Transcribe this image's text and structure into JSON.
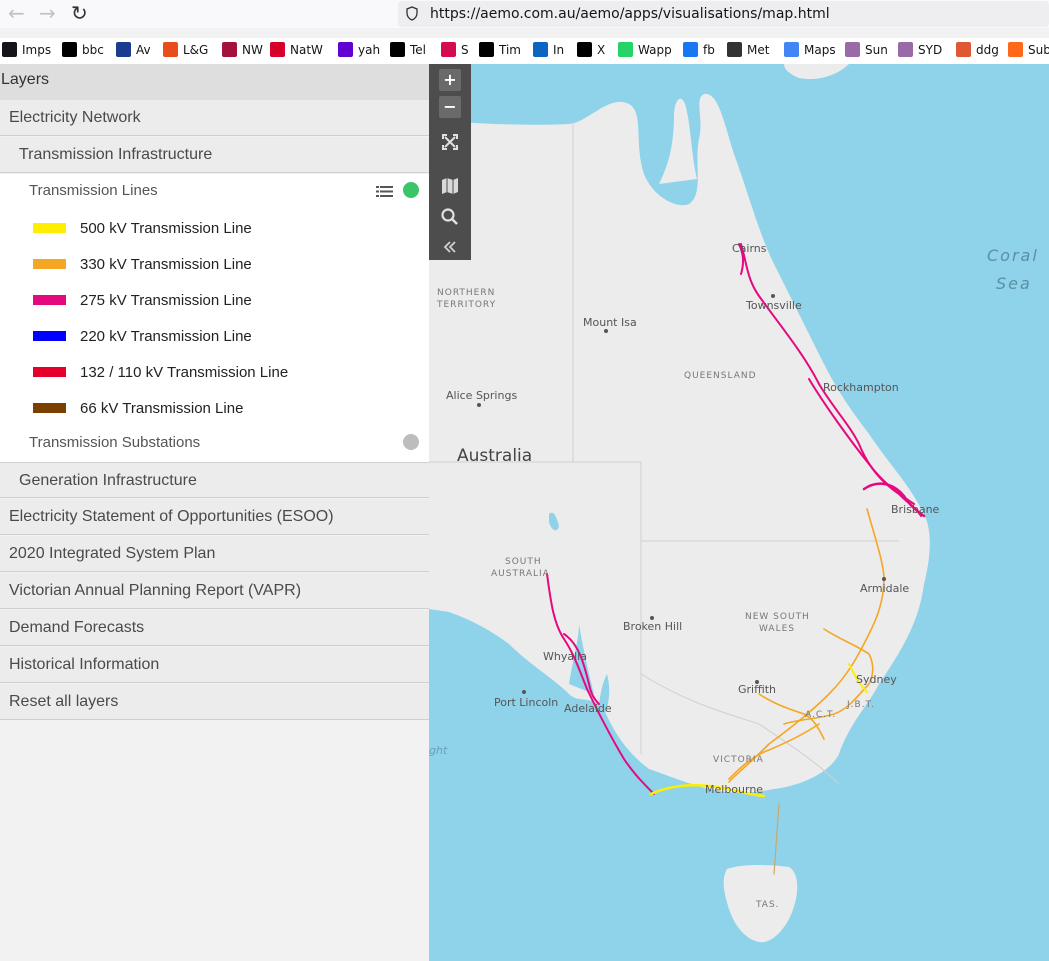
{
  "browser": {
    "url": "https://aemo.com.au/aemo/apps/visualisations/map.html",
    "back_icon": "arrow-left-icon",
    "forward_icon": "arrow-right-icon",
    "reload_icon": "reload-icon",
    "bookmarks": [
      {
        "label": "Imps",
        "icon": "folder-icon",
        "color": "#15141a"
      },
      {
        "label": "bbc",
        "icon": "bbc-icon",
        "color": "#000000"
      },
      {
        "label": "Av",
        "icon": "aviva-icon",
        "color": "#1a3c8f"
      },
      {
        "label": "L&G",
        "icon": "umbrella-icon",
        "color": "#e84e1b"
      },
      {
        "label": "NW",
        "icon": "nationwide-icon",
        "color": "#a3123b"
      },
      {
        "label": "NatW",
        "icon": "natwest-icon",
        "color": "#d7002a"
      },
      {
        "label": "yah",
        "icon": "yahoo-icon",
        "color": "#6001d2"
      },
      {
        "label": "Tel",
        "icon": "telegraph-icon",
        "color": "#000000"
      },
      {
        "label": "S",
        "icon": "s-icon",
        "color": "#d40b53"
      },
      {
        "label": "Tim",
        "icon": "times-icon",
        "color": "#000000"
      },
      {
        "label": "In",
        "icon": "linkedin-icon",
        "color": "#0a66c2"
      },
      {
        "label": "X",
        "icon": "x-icon",
        "color": "#000000"
      },
      {
        "label": "Wapp",
        "icon": "whatsapp-icon",
        "color": "#25d366"
      },
      {
        "label": "fb",
        "icon": "facebook-icon",
        "color": "#1877f2"
      },
      {
        "label": "Met",
        "icon": "met-icon",
        "color": "#333333"
      },
      {
        "label": "Maps",
        "icon": "google-icon",
        "color": "#4285f4"
      },
      {
        "label": "Sun",
        "icon": "sun-icon",
        "color": "#9a6aa8"
      },
      {
        "label": "SYD",
        "icon": "syd-icon",
        "color": "#9a6aa8"
      },
      {
        "label": "ddg",
        "icon": "duckduckgo-icon",
        "color": "#de5833"
      },
      {
        "label": "Sub",
        "icon": "substack-icon",
        "color": "#ff6719"
      }
    ]
  },
  "sidebar": {
    "title": "Layers",
    "electricity_network": "Electricity Network",
    "transmission_infrastructure": "Transmission Infrastructure",
    "transmission_lines": "Transmission Lines",
    "list_icon": "list-icon",
    "lines_status_color": "#3cc468",
    "legend": [
      {
        "label": "500 kV Transmission Line",
        "color": "#ffee00"
      },
      {
        "label": "330 kV Transmission Line",
        "color": "#f5a623"
      },
      {
        "label": "275 kV Transmission Line",
        "color": "#e5097f"
      },
      {
        "label": "220 kV Transmission Line",
        "color": "#0000ff"
      },
      {
        "label": "132 / 110 kV Transmission Line",
        "color": "#e4002b"
      },
      {
        "label": "66 kV Transmission Line",
        "color": "#7b3f00"
      }
    ],
    "transmission_substations": "Transmission Substations",
    "substations_status_color": "#bdbdbd",
    "generation_infrastructure": "Generation Infrastructure",
    "sections": [
      "Electricity Statement of Opportunities (ESOO)",
      "2020 Integrated System Plan",
      "Victorian Annual Planning Report (VAPR)",
      "Demand Forecasts",
      "Historical Information",
      "Reset all layers"
    ]
  },
  "map_tools": {
    "zoom_in": "+",
    "zoom_out": "−",
    "fullscreen_icon": "fullscreen-icon",
    "basemap_icon": "map-icon",
    "search_icon": "search-icon",
    "collapse_icon": "double-chevron-left-icon"
  },
  "map": {
    "country": "Australia",
    "sea": [
      "Coral",
      "Sea"
    ],
    "regions": [
      "NORTHERN",
      "TERRITORY",
      "QUEENSLAND",
      "SOUTH",
      "AUSTRALIA",
      "NEW SOUTH",
      "WALES",
      "VICTORIA",
      "A.C.T.",
      "J.B.T.",
      "TAS."
    ],
    "cities": [
      "Cairns",
      "Townsville",
      "Mount Isa",
      "Rockhampton",
      "Alice Springs",
      "Brisbane",
      "Armidale",
      "Broken Hill",
      "Whyalla",
      "Sydney",
      "Griffith",
      "Port Lincoln",
      "Adelaide",
      "Melbourne"
    ],
    "partial_labels": [
      "ght"
    ]
  }
}
